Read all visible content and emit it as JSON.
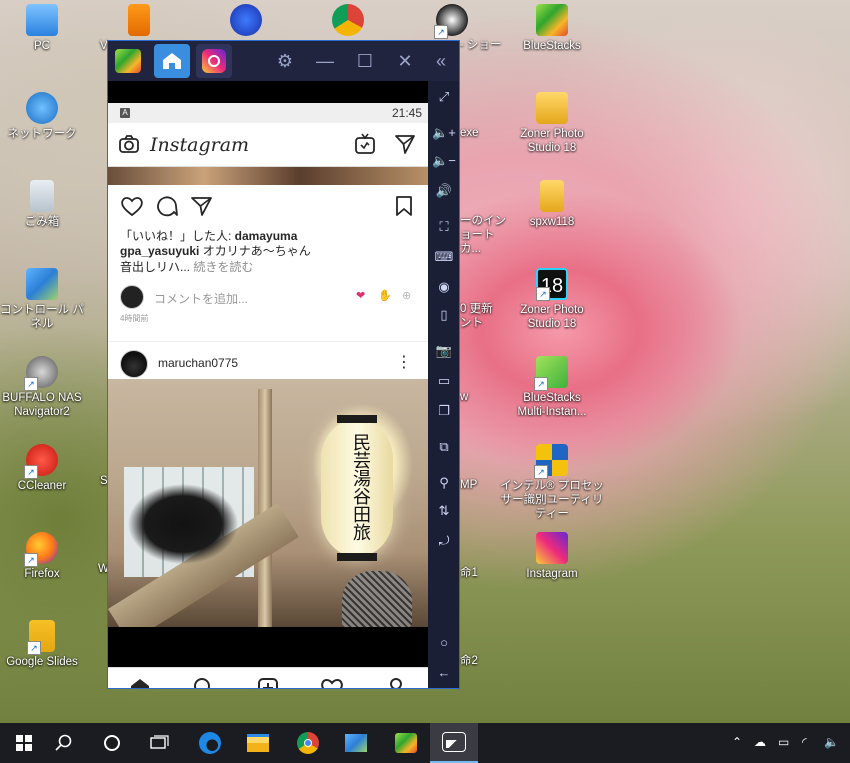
{
  "desktop": {
    "icons": [
      {
        "label": "PC"
      },
      {
        "label": "ネットワーク"
      },
      {
        "label": "ごみ箱"
      },
      {
        "label": "コントロール パネル"
      },
      {
        "label": "BUFFALO NAS Navigator2"
      },
      {
        "label": "CCleaner"
      },
      {
        "label": "Firefox"
      },
      {
        "label": "Google Slides"
      },
      {
        "label": "BlueStacks"
      },
      {
        "label": "Zoner Photo Studio 18"
      },
      {
        "label": "spxw118"
      },
      {
        "label": "Zoner Photo Studio 18"
      },
      {
        "label": "BlueStacks Multi-Instan..."
      },
      {
        "label": "インテル® プロセッサー識別ユーティリティー"
      },
      {
        "label": "Instagram"
      },
      {
        "label": "V"
      },
      {
        "label": "- ショー"
      },
      {
        "label": "exe"
      },
      {
        "label": "ーのイン"
      },
      {
        "label": "ョートカ..."
      },
      {
        "label": "0 更新"
      },
      {
        "label": "ント"
      },
      {
        "label": "w"
      },
      {
        "label": "MP"
      },
      {
        "label": "命1"
      },
      {
        "label": "命2"
      },
      {
        "label": "S"
      },
      {
        "label": "W"
      }
    ]
  },
  "emulator": {
    "statusbar": {
      "time": "21:45"
    },
    "instagram": {
      "logo": "Instagram",
      "likes_prefix": "「いいね！」した人: ",
      "likes_user": "damayuma",
      "caption_user": "gpa_yasuyuki",
      "caption_text": " オカリナあ〜ちゃん",
      "caption_line2": "音出しリハ...",
      "more_label": "続きを読む",
      "comment_placeholder": "コメントを追加...",
      "time_ago": "4時間前",
      "next_post_user": "maruchan0775",
      "lantern_text": "民芸湯谷田旅"
    }
  },
  "colors": {
    "accent": "#2a6bd1",
    "ig_text": "#262626"
  }
}
